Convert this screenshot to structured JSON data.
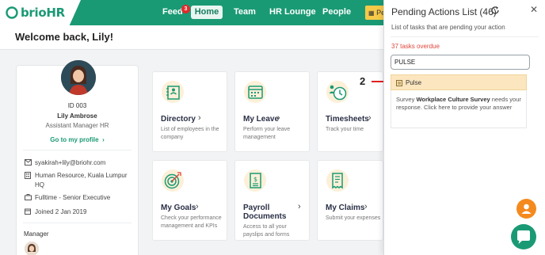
{
  "app": {
    "logo_text": "brioHR"
  },
  "nav": {
    "feed_label": "Feed",
    "feed_badge": "3",
    "home_label": "Home",
    "team_label": "Team",
    "lounge_label": "HR Lounge",
    "people_label": "People",
    "pending_chip_label": "Pe"
  },
  "welcome": {
    "text": "Welcome back, Lily!"
  },
  "profile": {
    "id": "ID 003",
    "name": "Lily Ambrose",
    "title": "Assistant Manager HR",
    "link": "Go to my profile",
    "email": "syakirah+lily@briohr.com",
    "department": "Human Resource, Kuala Lumpur HQ",
    "employment": "Fulltime - Senior Executive",
    "joined": "Joined 2 Jan 2019",
    "manager_label": "Manager"
  },
  "tiles": [
    {
      "title": "Directory",
      "desc": "List of employees in the company",
      "icon": "directory-icon"
    },
    {
      "title": "My Leave",
      "desc": "Perform your leave management",
      "icon": "calendar-icon"
    },
    {
      "title": "Timesheets",
      "desc": "Track your time",
      "icon": "timesheet-clock-icon"
    },
    {
      "title": "My Goals",
      "desc": "Check your performance management and KPIs",
      "icon": "target-icon"
    },
    {
      "title": "Payroll Documents",
      "desc": "Access to all your payslips and forms",
      "icon": "payroll-document-icon"
    },
    {
      "title": "My Claims",
      "desc": "Submit your expenses",
      "icon": "receipt-icon"
    }
  ],
  "panel": {
    "title": "Pending Actions List (46)",
    "subtitle": "List of tasks that are pending your action",
    "overdue": "37 tasks overdue",
    "search_value": "PULSE",
    "item_title": "Pulse",
    "item_body_prefix": "Survey ",
    "item_body_survey": "Workplace Culture Survey",
    "item_body_suffix": " needs your response. Click here to provide your answer"
  },
  "annotation": {
    "step": "2"
  },
  "colors": {
    "brand": "#1a9a74",
    "overdue": "#e0463b",
    "highlight": "#fce6bf",
    "fab_orange": "#f48a1e"
  }
}
